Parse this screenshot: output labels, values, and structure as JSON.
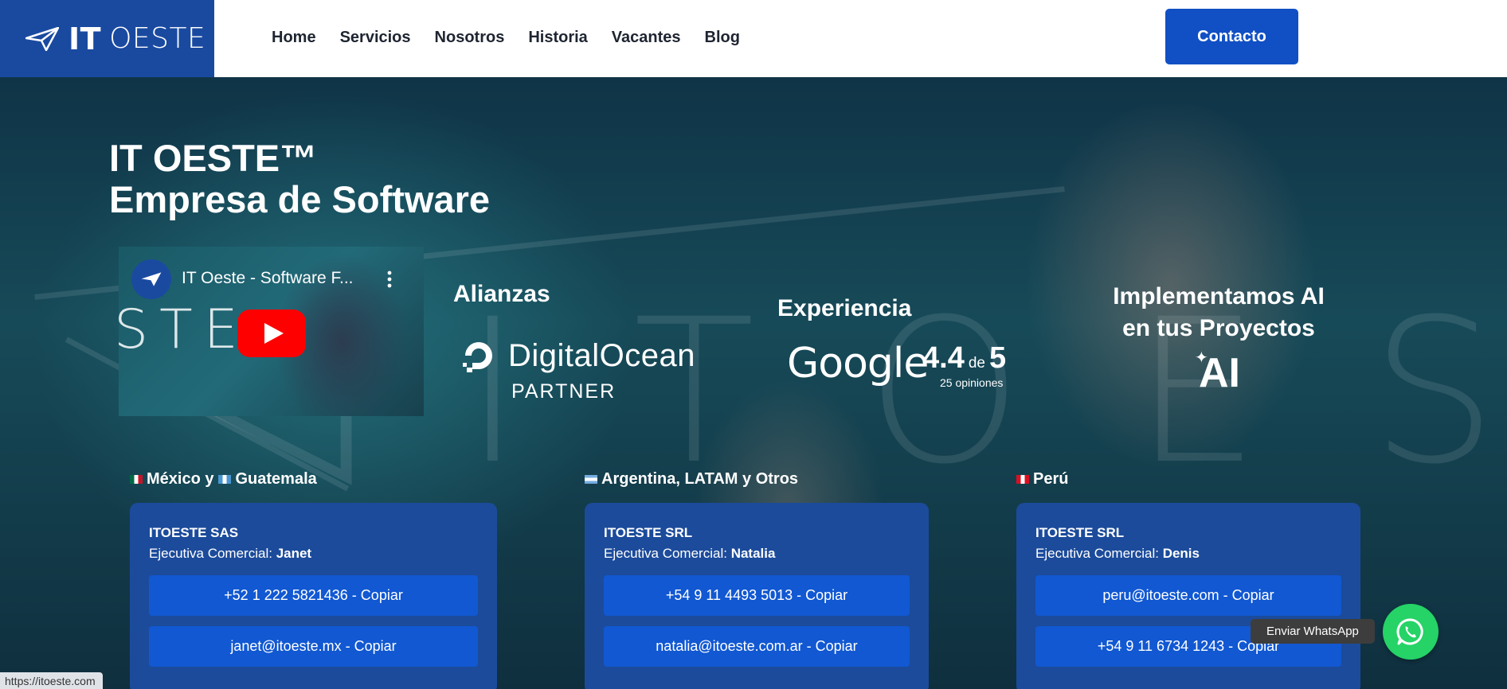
{
  "header": {
    "logo": {
      "bold": "IT",
      "light": "OESTE",
      "icon": "paper-plane-icon"
    },
    "nav": [
      {
        "label": "Home"
      },
      {
        "label": "Servicios"
      },
      {
        "label": "Nosotros"
      },
      {
        "label": "Historia"
      },
      {
        "label": "Vacantes"
      },
      {
        "label": "Blog"
      }
    ],
    "contact_label": "Contacto"
  },
  "hero": {
    "title_line1": "IT OESTE™",
    "title_line2": "Empresa de Software",
    "video": {
      "title": "IT Oeste - Software F...",
      "channel_icon": "paper-plane-icon",
      "play_icon": "youtube-play-icon"
    },
    "alliances": {
      "heading": "Alianzas",
      "partner_name": "DigitalOcean",
      "partner_sub": "PARTNER"
    },
    "experience": {
      "heading": "Experiencia",
      "brand": "Google",
      "rating": "4.4",
      "rating_de": "de",
      "rating_max": "5",
      "reviews": "25 opiniones"
    },
    "ai": {
      "heading_line1": "Implementamos AI",
      "heading_line2": "en tus Proyectos",
      "logo_text": "AI"
    }
  },
  "offices": [
    {
      "region_parts": [
        "México y",
        "Guatemala"
      ],
      "company": "ITOESTE SAS",
      "exec_label": "Ejecutiva Comercial:",
      "exec_name": "Janet",
      "buttons": [
        "+52 1 222 5821436 - Copiar",
        "janet@itoeste.mx - Copiar"
      ]
    },
    {
      "region_parts": [
        "Argentina, LATAM y Otros"
      ],
      "company": "ITOESTE SRL",
      "exec_label": "Ejecutiva Comercial:",
      "exec_name": "Natalia",
      "buttons": [
        "+54 9 11 4493 5013 - Copiar",
        "natalia@itoeste.com.ar - Copiar"
      ]
    },
    {
      "region_parts": [
        "Perú"
      ],
      "company": "ITOESTE SRL",
      "exec_label": "Ejecutiva Comercial:",
      "exec_name": "Denis",
      "buttons": [
        "peru@itoeste.com - Copiar",
        "+54 9 11 6734 1243 - Copiar"
      ]
    }
  ],
  "whatsapp": {
    "label": "Enviar WhatsApp",
    "icon": "whatsapp-icon"
  },
  "status_bar": {
    "url": "https://itoeste.com"
  },
  "colors": {
    "brand_blue": "#1a4aa0",
    "button_blue": "#1150c4",
    "card_blue": "#1c4b9b",
    "copy_blue": "#1158d2",
    "whatsapp_green": "#25d366"
  }
}
